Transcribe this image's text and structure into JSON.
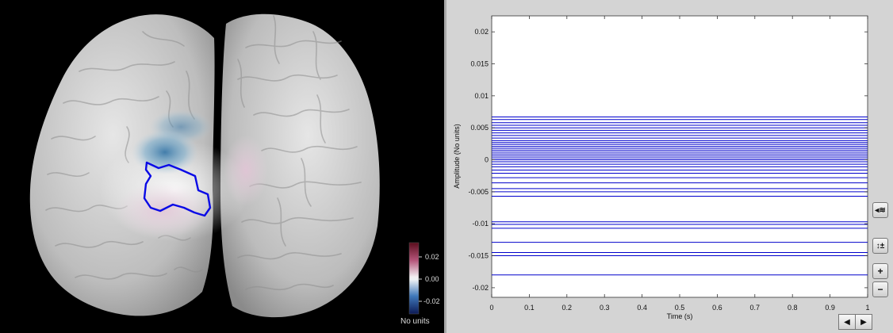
{
  "brain_view": {
    "colorbar": {
      "ticks": [
        "0.02",
        "0.00",
        "-0.02"
      ],
      "unit_label": "No units"
    }
  },
  "time_series": {
    "buttons": {
      "montage_icon": "◂≋",
      "scale_icon": "↕±",
      "zoom_in": "+",
      "zoom_out": "−",
      "scroll_left": "◀",
      "scroll_right": "▶"
    }
  },
  "chart_data": {
    "type": "line",
    "xlabel": "Time (s)",
    "ylabel": "Amplitude (No units)",
    "xlim": [
      0,
      1
    ],
    "ylim": [
      -0.0215,
      0.0225
    ],
    "x_ticks": [
      0,
      0.1,
      0.2,
      0.3,
      0.4,
      0.5,
      0.6,
      0.7,
      0.8,
      0.9,
      1
    ],
    "x_tick_labels": [
      "0",
      "0.1",
      "0.2",
      "0.3",
      "0.4",
      "0.5",
      "0.6",
      "0.7",
      "0.8",
      "0.9",
      "1"
    ],
    "y_ticks": [
      0.02,
      0.015,
      0.01,
      0.005,
      0,
      -0.005,
      -0.01,
      -0.015,
      -0.02
    ],
    "y_tick_labels": [
      "0.02",
      "0.015",
      "0.01",
      "0.005",
      "0",
      "-0.005",
      "-0.01",
      "-0.015",
      "-0.02"
    ],
    "grid": false,
    "series_color": "#0000cc",
    "series_constant_values": [
      0.0067,
      0.0063,
      0.0058,
      0.0054,
      0.005,
      0.0046,
      0.0042,
      0.0038,
      0.0034,
      0.003,
      0.0027,
      0.0024,
      0.0021,
      0.0018,
      0.0015,
      0.0012,
      0.0009,
      0.0006,
      0.0003,
      0.0,
      -0.0003,
      -0.0007,
      -0.0011,
      -0.0016,
      -0.0021,
      -0.0028,
      -0.0036,
      -0.0045,
      -0.005,
      -0.0057,
      -0.0097,
      -0.0101,
      -0.0107,
      -0.0129,
      -0.0145,
      -0.015,
      -0.018
    ]
  }
}
